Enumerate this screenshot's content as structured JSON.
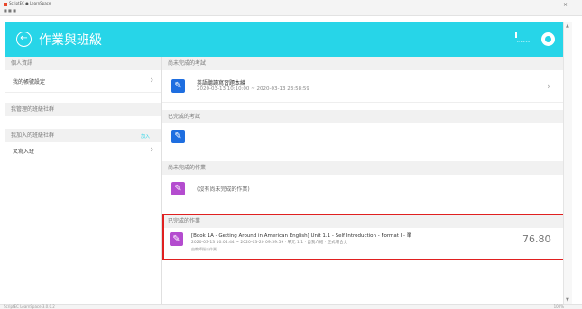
{
  "window": {
    "title": "ScriptEC ● LearnSpace",
    "menu": "■ ■ ■",
    "min_glyph": "–",
    "close_glyph": "×"
  },
  "header": {
    "back_icon": "circle-arrow-left-icon",
    "back_glyph": "←",
    "title": "作業與班級",
    "bg_color": "#27d5e8",
    "small_text": "EF9.4.1.0"
  },
  "sidebar": {
    "sections": [
      {
        "head": "個人資訊",
        "item": "我的帳號設定"
      },
      {
        "head": "我管理的班級社群"
      },
      {
        "head": "我加入的班級社群",
        "badge": "加入",
        "item": "又寫入班"
      }
    ]
  },
  "main": {
    "unfinished_exams": {
      "head": "尚未完成的考試",
      "item_title": "英語聽讀寫習題本練",
      "item_dates": "2020-03-13 10:10:00 ~ 2020-03-13 23:58:59"
    },
    "finished_exams": {
      "head": "已完成的考試"
    },
    "unfinished_homework": {
      "head": "尚未完成的作業",
      "empty_text": "(沒有尚未完成的作業)"
    },
    "finished_homework": {
      "head": "已完成的作業",
      "item_title": "[Book 1A - Getting Around in American English] Unit 1.1 - Self Introduction - Format I - 單",
      "item_line2": "2020-03-13 10:04:44 ~ 2020-03-20 09:59:59 · 單元 1.1 · 自我介紹 · 正式場合文",
      "item_line3": "由教師指派作業",
      "score": "76.80"
    }
  },
  "icons": {
    "pencil": "pencil-icon",
    "chevron": "chevron-right-icon",
    "scroll_up": "▲",
    "scroll_down": "▼",
    "chevron_glyph": "›"
  },
  "status": {
    "left": "ScriptEC LearnSpace 3.0.0.2",
    "right": "100%"
  }
}
